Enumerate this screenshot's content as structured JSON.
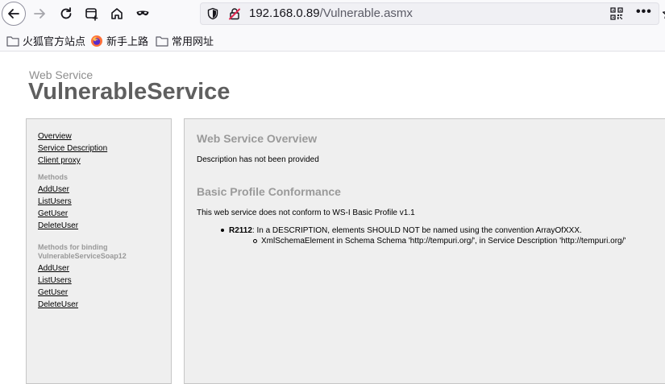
{
  "browser": {
    "url_host": "192.168.0.89",
    "url_path": "/Vulnerable.asmx",
    "bookmarks": [
      "火狐官方站点",
      "新手上路",
      "常用网址"
    ]
  },
  "page": {
    "subtitle": "Web Service",
    "title": "VulnerableService",
    "sidebar": {
      "top_links": [
        "Overview",
        "Service Description",
        "Client proxy"
      ],
      "methods_heading": "Methods",
      "methods": [
        "AddUser",
        "ListUsers",
        "GetUser",
        "DeleteUser"
      ],
      "binding_heading_1": "Methods for binding",
      "binding_heading_2": "VulnerableServiceSoap12",
      "binding_methods": [
        "AddUser",
        "ListUsers",
        "GetUser",
        "DeleteUser"
      ]
    },
    "main": {
      "overview_heading": "Web Service Overview",
      "overview_text": "Description has not been provided",
      "profile_heading": "Basic Profile Conformance",
      "profile_text": "This web service does not conform to WS-I Basic Profile v1.1",
      "rule_id": "R2112",
      "rule_text": ": In a DESCRIPTION, elements SHOULD NOT be named using the convention ArrayOfXXX.",
      "rule_detail": "XmlSchemaElement in Schema Schema 'http://tempuri.org/', in Service Description 'http://tempuri.org/'"
    }
  },
  "colors": {
    "heading_gray": "#9a9a9a",
    "title_gray": "#5f5f5f",
    "panel_bg": "#efefef",
    "insecure_red": "#e22850"
  }
}
